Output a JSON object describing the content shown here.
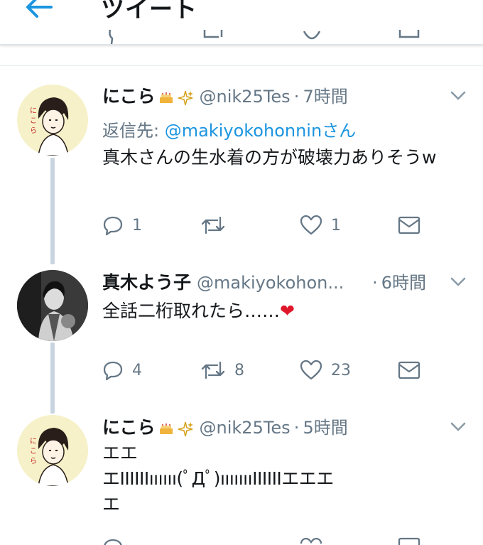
{
  "header": {
    "title": "ツイート"
  },
  "tweets": [
    {
      "name": "にこら",
      "handle": "@nik25Tes",
      "dot": "·",
      "time": "7時間",
      "reply_prefix": "返信先: ",
      "reply_handle": "@makiyokohonninさん",
      "text": "真木さんの生水着の方が破壊力ありそうw",
      "reply_count": "1",
      "retweet_count": "",
      "like_count": "1"
    },
    {
      "name": "真木よう子",
      "handle": "@makiyokohon...",
      "dot": "·",
      "time": "6時間",
      "text": "全話二桁取れたら……",
      "heart_emoji": "❤",
      "reply_count": "4",
      "retweet_count": "8",
      "like_count": "23"
    },
    {
      "name": "にこら",
      "handle": "@nik25Tes",
      "dot": "·",
      "time": "5時間",
      "text_line1": "エエ",
      "text_line2": "エIIIIIIıııııı(ﾟДﾟ)ıııııııIIIIIIエエエ",
      "text_line3": "エ"
    }
  ],
  "colors": {
    "accent": "#1b95e0",
    "muted": "#657786",
    "thread": "#c8d5e0",
    "heart": "#e0162b"
  },
  "icons": [
    "back-arrow-icon",
    "chevron-down-icon",
    "reply-icon",
    "retweet-icon",
    "like-icon",
    "message-icon"
  ]
}
